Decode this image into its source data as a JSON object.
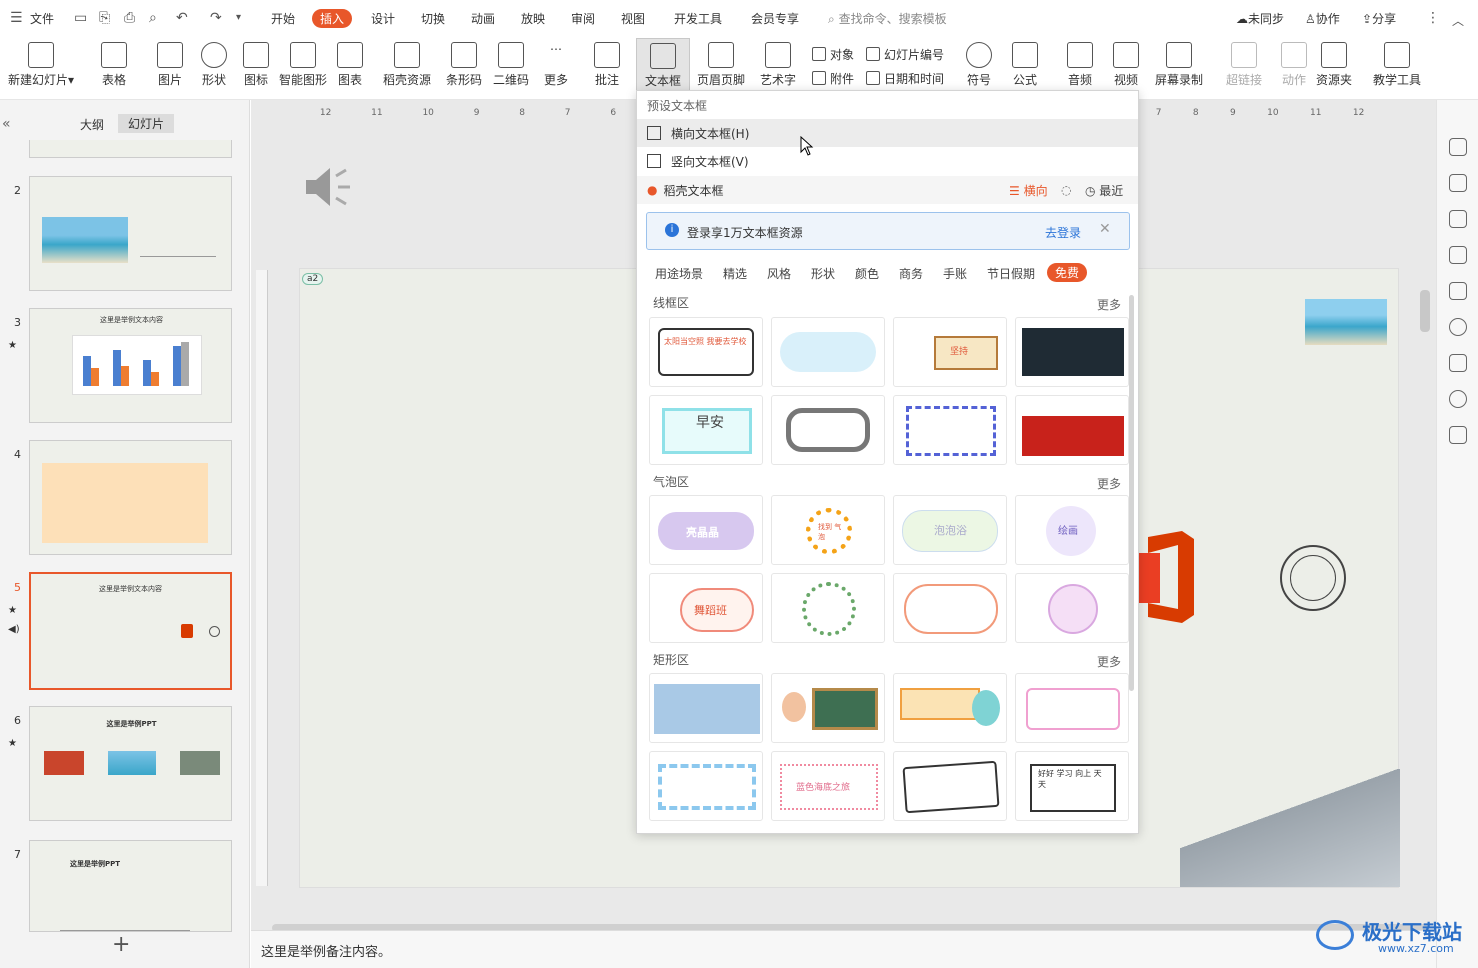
{
  "menu": {
    "file": "文件",
    "tabs": [
      "开始",
      "插入",
      "设计",
      "切换",
      "动画",
      "放映",
      "审阅",
      "视图",
      "开发工具",
      "会员专享"
    ],
    "active_tab": "插入",
    "search_placeholder": "查找命令、搜索模板",
    "sync": "未同步",
    "collab": "协作",
    "share": "分享"
  },
  "ribbon": {
    "new_slide": "新建幻灯片",
    "table": "表格",
    "picture": "图片",
    "shape": "形状",
    "icon": "图标",
    "smartart": "智能图形",
    "chart": "图表",
    "daoke": "稻壳资源",
    "barcode": "条形码",
    "qrcode": "二维码",
    "more": "更多",
    "comment": "批注",
    "textbox": "文本框",
    "header_footer": "页眉页脚",
    "wordart": "艺术字",
    "object": "对象",
    "attachment": "附件",
    "slide_number": "幻灯片编号",
    "datetime": "日期和时间",
    "symbol": "符号",
    "formula": "公式",
    "audio": "音频",
    "video": "视频",
    "screen_record": "屏幕录制",
    "hyperlink": "超链接",
    "action": "动作",
    "resource": "资源夹",
    "teach": "教学工具"
  },
  "left_pane": {
    "tab_outline": "大纲",
    "tab_slides": "幻灯片",
    "slides": [
      {
        "num": "2",
        "title": ""
      },
      {
        "num": "3",
        "title": "这里是举例文本内容"
      },
      {
        "num": "4",
        "title": ""
      },
      {
        "num": "5",
        "title": "这里是举例文本内容"
      },
      {
        "num": "6",
        "title": "这里是举例PPT"
      },
      {
        "num": "7",
        "title": "这里是举例PPT"
      }
    ],
    "selected": "5"
  },
  "ruler": {
    "top_left": [
      "12",
      "11",
      "10",
      "9",
      "8",
      "7",
      "6"
    ],
    "top_right": [
      "7",
      "8",
      "9",
      "10",
      "11",
      "12"
    ]
  },
  "slide": {
    "badge": "a2"
  },
  "dropdown": {
    "preset_title": "预设文本框",
    "horizontal": "横向文本框(H)",
    "vertical": "竖向文本框(V)",
    "daoke": "稻壳文本框",
    "orientation": "横向",
    "recent": "最近",
    "login_banner": "登录享1万文本框资源",
    "login_link": "去登录",
    "categories": [
      "用途场景",
      "精选",
      "风格",
      "形状",
      "颜色",
      "商务",
      "手账",
      "节日假期",
      "免费"
    ],
    "active_category": "免费",
    "sections": [
      {
        "title": "线框区",
        "more": "更多",
        "cards": [
          "太阳当空照 我要去学校",
          "",
          "坚持",
          "",
          "早安",
          "",
          "",
          "",
          ""
        ]
      },
      {
        "title": "气泡区",
        "more": "更多",
        "cards": [
          "亮晶晶",
          "找到 气泡",
          "泡泡浴",
          "绘画",
          "舞蹈班",
          "",
          "",
          ""
        ]
      },
      {
        "title": "矩形区",
        "more": "更多",
        "cards": [
          "",
          "",
          "",
          "",
          "蓝色海底之旅",
          "",
          "好好 学习 向上 天天"
        ]
      }
    ]
  },
  "notes": "这里是举例备注内容。",
  "watermark": {
    "name": "极光下载站",
    "url": "www.xz7.com"
  },
  "colors": {
    "accent": "#e8572a",
    "login_bg": "#eef4fb",
    "link": "#2b74d8"
  }
}
